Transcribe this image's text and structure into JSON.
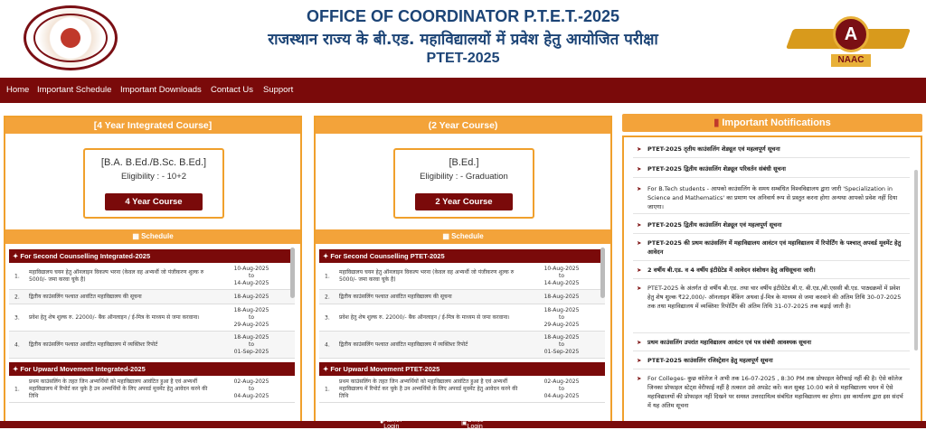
{
  "header": {
    "title_line1": "OFFICE OF COORDINATOR P.T.E.T.-2025",
    "title_line2": "राजस्थान राज्य के बी.एड. महाविद्यालयों में प्रवेश हेतु आयोजित परीक्षा",
    "title_line3": "PTET-2025",
    "naac_letter": "A",
    "naac_text": "NAAC"
  },
  "nav": {
    "items": [
      "Home",
      "Important Schedule",
      "Important Downloads",
      "Contact Us",
      "Support"
    ]
  },
  "courses": [
    {
      "header": "[4 Year Integrated Course]",
      "name": "[B.A. B.Ed./B.Sc. B.Ed.]",
      "eligibility": "Eligibility : - 10+2",
      "button": "4 Year Course",
      "schedule_label": "Schedule",
      "section1": "For Second Counselling Integrated-2025",
      "rows": [
        {
          "no": "1.",
          "text": "महाविद्यालय चयन हेतु ऑनलाइन विकल्प भरना (केवल वह अभ्यर्थी जो पंजीकरण शुल्क रु 5000/- जमा करवा चुके है)",
          "date": "10-Aug-2025\nto\n14-Aug-2025"
        },
        {
          "no": "2.",
          "text": "द्वितीय काउंसलिंग पश्चात आवंटित महाविद्यालय की सूचना",
          "date": "18-Aug-2025"
        },
        {
          "no": "3.",
          "text": "प्रवेश हेतु शेष शुल्क रु. 22000/- बैंक ऑनलाइन / ई-मित्र के माध्यम से जमा करवाना।",
          "date": "18-Aug-2025\nto\n29-Aug-2025"
        },
        {
          "no": "4.",
          "text": "द्वितीय काउंसलिंग पश्चात आवंटित महाविद्यालय में व्यक्तिशः रिपोर्ट",
          "date": "18-Aug-2025\nto\n01-Sep-2025"
        }
      ],
      "section2": "For Upward Movement Integrated-2025",
      "row5": {
        "no": "1.",
        "text": "प्रथम काउंसलिंग के तहत जिन अभ्यर्थियों को महाविद्यालय आवंटित हुआ है एवं अभ्यर्थी महाविद्यालय में रिपोर्ट कर चुके है उन अभ्यर्थियों के लिए अपवर्ड मूवमेंट हेतु आवेदन करने की तिथि",
        "date": "02-Aug-2025\nto\n04-Aug-2025"
      }
    },
    {
      "header": "(2 Year Course)",
      "name": "[B.Ed.]",
      "eligibility": "Eligibility : - Graduation",
      "button": "2 Year Course",
      "schedule_label": "Schedule",
      "section1": "For Second Counselling PTET-2025",
      "rows": [
        {
          "no": "1.",
          "text": "महाविद्यालय चयन हेतु ऑनलाइन विकल्प भरना (केवल वह अभ्यर्थी जो पंजीकरण शुल्क रु 5000/- जमा करवा चुके है)",
          "date": "10-Aug-2025\nto\n14-Aug-2025"
        },
        {
          "no": "2.",
          "text": "द्वितीय काउंसलिंग पश्चात आवंटित महाविद्यालय की सूचना",
          "date": "18-Aug-2025"
        },
        {
          "no": "3.",
          "text": "प्रवेश हेतु शेष शुल्क रु. 22000/- बैंक ऑनलाइन / ई-मित्र के माध्यम से जमा करवाना।",
          "date": "18-Aug-2025\nto\n29-Aug-2025"
        },
        {
          "no": "4.",
          "text": "द्वितीय काउंसलिंग पश्चात आवंटित महाविद्यालय में व्यक्तिशः रिपोर्ट",
          "date": "18-Aug-2025\nto\n01-Sep-2025"
        }
      ],
      "section2": "For Upward Movement PTET-2025",
      "row5": {
        "no": "1.",
        "text": "प्रथम काउंसलिंग के तहत जिन अभ्यर्थियों को महाविद्यालय आवंटित हुआ है एवं अभ्यर्थी महाविद्यालय में रिपोर्ट कर चुके है उन अभ्यर्थियों के लिए अपवर्ड मूवमेंट हेतु आवेदन करने की तिथि",
        "date": "02-Aug-2025\nto\n04-Aug-2025"
      }
    }
  ],
  "notifications": {
    "header": "Important Notifications",
    "items": [
      "PTET-2025 तृतीय काउंसलिंग शेड्यूल एवं महत्वपूर्ण सूचना",
      "PTET-2025 द्वितीय काउंसलिंग शेड्यूल परिवर्तन संबंधी सूचना",
      "For B.Tech students - आपको काउंसलिंग के समय सम्बंधित विश्वविद्यालय द्वारा जारी 'Specialization in Science and Mathematics' का प्रमाण पत्र अनिवार्य रूप से प्रस्तुत करना होगा अन्यथा आपको प्रवेश नहीं दिया जाएगा।",
      "PTET-2025 द्वितीय काउंसलिंग शेड्यूल एवं महत्वपूर्ण सूचना",
      "PTET-2025 की प्रथम काउंसलिंग में महाविद्यालय आवंटन एवं महाविद्यालय में रिपोर्टिंग के पश्चात् अपवर्ड मूवमेंट हेतु आवेदन",
      "2 वर्षीय बी.एड. व 4 वर्षीय इंटीग्रेटेड में आवेदन संशोधन हेतु अधिसूचना जारी।",
      "PTET-2025 के अंतर्गत दो वर्षीय बी.एड. तथा चार वर्षीय इंटीग्रेटेड बी.ए. बी.एड./बी.एससी बी.एड. पाठ्यक्रमों में प्रवेश हेतु शेष शुल्क ₹22,000/- ऑनलाइन बैंकिंग अथवा ई-मित्र के माध्यम से जमा करवाने की अंतिम तिथि 30-07-2025 तक तथा महाविद्यालय में व्यक्तिशः रिपोर्टिंग की अंतिम तिथि 31-07-2025 तक बढ़ाई जाती है।",
      "प्रथम काउंसलिंग उपरांत महाविद्यालय आवंटन एवं पत्र संबंधी आवश्यक सूचना",
      "PTET-2025 काउंसलिंग रजिस्ट्रेशन हेतु महत्वपूर्ण सूचना",
      "For Colleges- कुछ कॉलेज ने अभी तक 16-07-2025 , 8:30 PM तक प्रोफाइल वेरीफाई नहीं की है। ऐसे कॉलेज जिनका प्रोफाइल स्टेट्स वेरीफाई नहीं है तत्काल उसे अपडेट करें। कल सुबह 10:00 बजे से महाविद्यालय चयन में ऐसे महाविद्यालयों की प्रोफाइल नहीं दिखने पर समस्त उत्तरदायित्व संबंधित महाविद्यालय का होगा। इस कार्यालय द्वारा इस संदर्भ में यह अंतिम सूचना"
    ]
  },
  "footer": {
    "admin_login": "Admin Login",
    "office_login": "Office Login"
  }
}
